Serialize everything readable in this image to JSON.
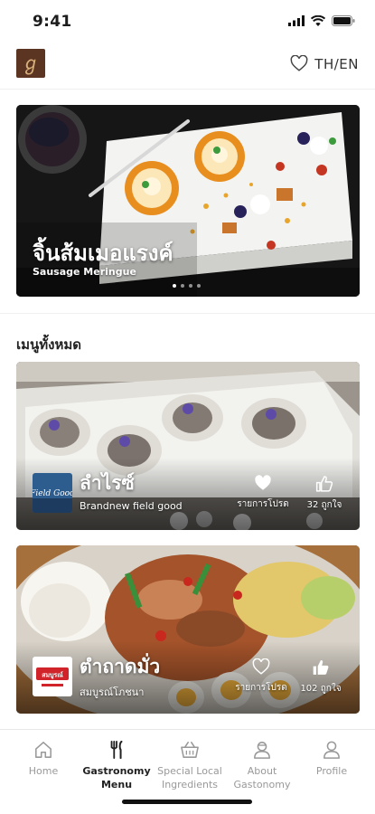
{
  "status_bar": {
    "time": "9:41",
    "icons": [
      "cellular-signal-icon",
      "wifi-icon",
      "battery-icon"
    ]
  },
  "header": {
    "logo_glyph": "ℊ",
    "favorite_icon": "heart-outline-icon",
    "language_label": "TH/EN"
  },
  "hero": {
    "title": "จิ้นส้มเมอแรงค์",
    "subtitle": "Sausage Meringue",
    "carousel_pages": 4,
    "active_page": 1
  },
  "menu_section": {
    "title": "เมนูทั้งหมด"
  },
  "menu_items": [
    {
      "title": "ลำไรซ์",
      "brand": "Brandnew field good",
      "brand_logo_text": "Field Good",
      "favorite_label": "รายการโปรด",
      "likes_label": "32 ถูกใจ",
      "favorited": true
    },
    {
      "title": "ตำถาดมั่ว",
      "brand": "สมบูรณ์โภชนา",
      "brand_logo_text": "สมบูรณ์",
      "favorite_label": "รายการโปรด",
      "likes_label": "102 ถูกใจ",
      "favorited": false
    }
  ],
  "bottom_nav": {
    "items": [
      {
        "label": "Home",
        "icon": "home-icon",
        "active": false
      },
      {
        "label": "Gastronomy Menu",
        "icon": "fork-knife-icon",
        "active": true
      },
      {
        "label": "Special Local Ingredients",
        "icon": "basket-icon",
        "active": false
      },
      {
        "label": "About Gastonomy",
        "icon": "chef-icon",
        "active": false
      },
      {
        "label": "Profile",
        "icon": "user-icon",
        "active": false
      }
    ]
  },
  "colors": {
    "brand_brown": "#5b3522",
    "nav_active": "#222222",
    "nav_inactive": "#999999"
  }
}
